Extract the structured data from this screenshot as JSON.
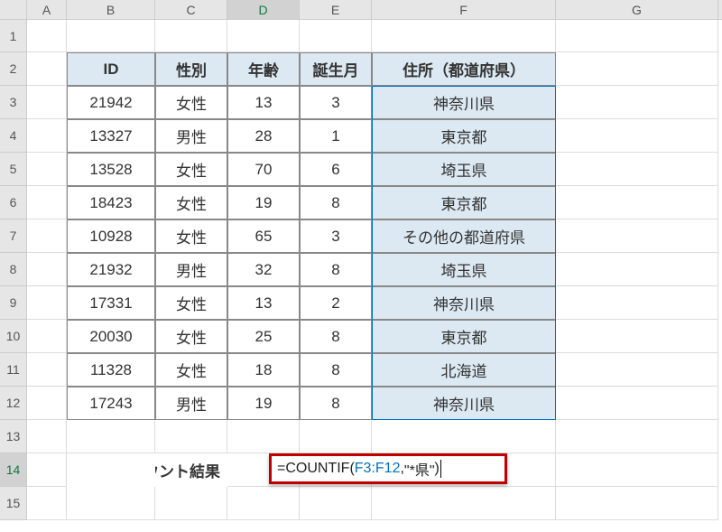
{
  "columns": [
    "A",
    "B",
    "C",
    "D",
    "E",
    "F",
    "G"
  ],
  "active_column": "D",
  "rows": [
    1,
    2,
    3,
    4,
    5,
    6,
    7,
    8,
    9,
    10,
    11,
    12,
    13,
    14,
    15
  ],
  "active_row": 14,
  "header_row": {
    "id": "ID",
    "sex": "性別",
    "age": "年齢",
    "birth_month": "誕生月",
    "address": "住所（都道府県）"
  },
  "data_rows": [
    {
      "id": "21942",
      "sex": "女性",
      "age": "13",
      "bm": "3",
      "addr": "神奈川県"
    },
    {
      "id": "13327",
      "sex": "男性",
      "age": "28",
      "bm": "1",
      "addr": "東京都"
    },
    {
      "id": "13528",
      "sex": "女性",
      "age": "70",
      "bm": "6",
      "addr": "埼玉県"
    },
    {
      "id": "18423",
      "sex": "女性",
      "age": "19",
      "bm": "8",
      "addr": "東京都"
    },
    {
      "id": "10928",
      "sex": "女性",
      "age": "65",
      "bm": "3",
      "addr": "その他の都道府県"
    },
    {
      "id": "21932",
      "sex": "男性",
      "age": "32",
      "bm": "8",
      "addr": "埼玉県"
    },
    {
      "id": "17331",
      "sex": "女性",
      "age": "13",
      "bm": "2",
      "addr": "神奈川県"
    },
    {
      "id": "20030",
      "sex": "女性",
      "age": "25",
      "bm": "8",
      "addr": "東京都"
    },
    {
      "id": "11328",
      "sex": "女性",
      "age": "18",
      "bm": "8",
      "addr": "北海道"
    },
    {
      "id": "17243",
      "sex": "男性",
      "age": "19",
      "bm": "8",
      "addr": "神奈川県"
    }
  ],
  "count_label": "カウント結果",
  "formula": {
    "eq": "=",
    "fn": "COUNTIF",
    "open": "(",
    "range": "F3:F12",
    "sep": ",",
    "arg": "\"*県\"",
    "close": ")"
  }
}
